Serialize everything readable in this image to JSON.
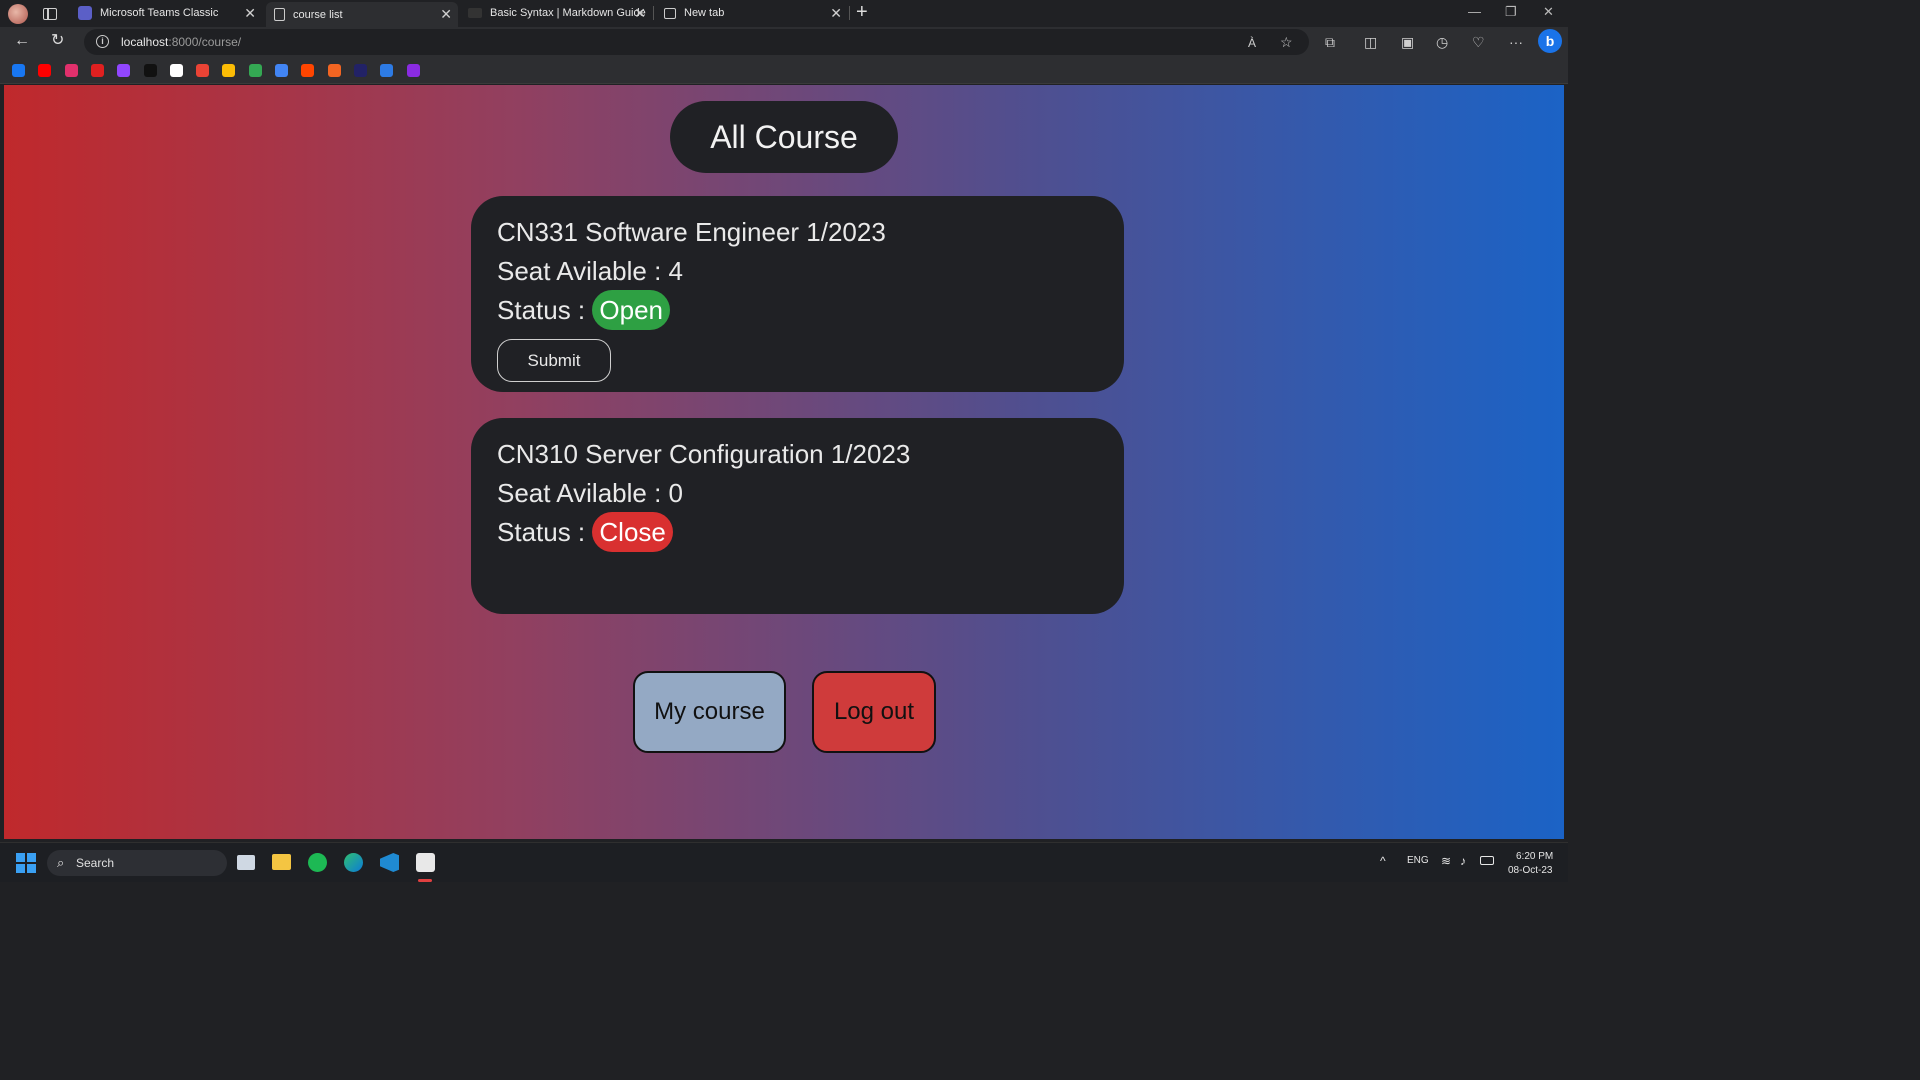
{
  "browser": {
    "tabs": [
      {
        "title": "Microsoft Teams Classic",
        "active": false
      },
      {
        "title": "course list",
        "active": true
      },
      {
        "title": "Basic Syntax | Markdown Guide",
        "active": false
      },
      {
        "title": "New tab",
        "active": false
      }
    ],
    "url_host": "localhost",
    "url_rest": ":8000/course/",
    "read_aloud_label": "À"
  },
  "bookmarks": [
    {
      "name": "facebook-bookmark-icon",
      "color": "#1877f2"
    },
    {
      "name": "youtube-bookmark-icon",
      "color": "#ff0000"
    },
    {
      "name": "instagram-bookmark-icon",
      "color": "#e1306c"
    },
    {
      "name": "youtube-music-bookmark-icon",
      "color": "#e02020"
    },
    {
      "name": "twitch-bookmark-icon",
      "color": "#9146ff"
    },
    {
      "name": "x-bookmark-icon",
      "color": "#111111"
    },
    {
      "name": "google-bookmark-icon",
      "color": "#ffffff"
    },
    {
      "name": "gmail-bookmark-icon",
      "color": "#ea4335"
    },
    {
      "name": "photos-bookmark-icon",
      "color": "#fbbc05"
    },
    {
      "name": "drive-bookmark-icon",
      "color": "#34a853"
    },
    {
      "name": "translate-bookmark-icon",
      "color": "#4285f4"
    },
    {
      "name": "reddit-bookmark-icon",
      "color": "#ff4500"
    },
    {
      "name": "ls-bookmark-icon",
      "color": "#f26522"
    },
    {
      "name": "dh-bookmark-icon",
      "color": "#222266"
    },
    {
      "name": "play-bookmark-icon",
      "color": "#2d7be5"
    },
    {
      "name": "purple-bookmark-icon",
      "color": "#8a2be2"
    }
  ],
  "page": {
    "heading": "All Course",
    "courses": [
      {
        "title": "CN331 Software Engineer 1/2023",
        "seat_label": "Seat Avilable : 4",
        "status_label": "Status :",
        "status": "Open",
        "status_color": "#2ea043",
        "button": "Submit"
      },
      {
        "title": "CN310 Server Configuration 1/2023",
        "seat_label": "Seat Avilable : 0",
        "status_label": "Status :",
        "status": "Close",
        "status_color": "#d93030"
      }
    ],
    "my_course_button": "My course",
    "my_course_color": "#94a9c4",
    "logout_button": "Log out",
    "logout_color": "#cf3b3b"
  },
  "taskbar": {
    "search_placeholder": "Search",
    "language": "ENG",
    "time": "6:20 PM",
    "date": "08-Oct-23"
  }
}
